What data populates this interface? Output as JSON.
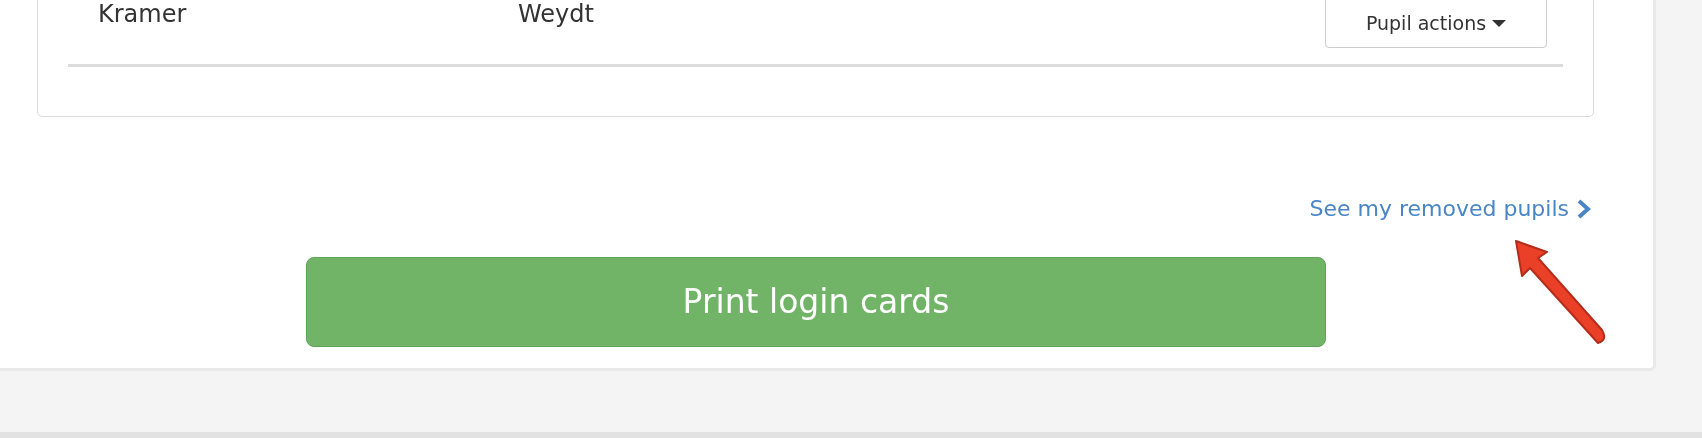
{
  "pupils": [
    {
      "column_1": "Kramer",
      "column_2": "Weydt",
      "action": "Pupil actions"
    }
  ],
  "removed_link": "See my removed pupils",
  "print_button": "Print login cards"
}
